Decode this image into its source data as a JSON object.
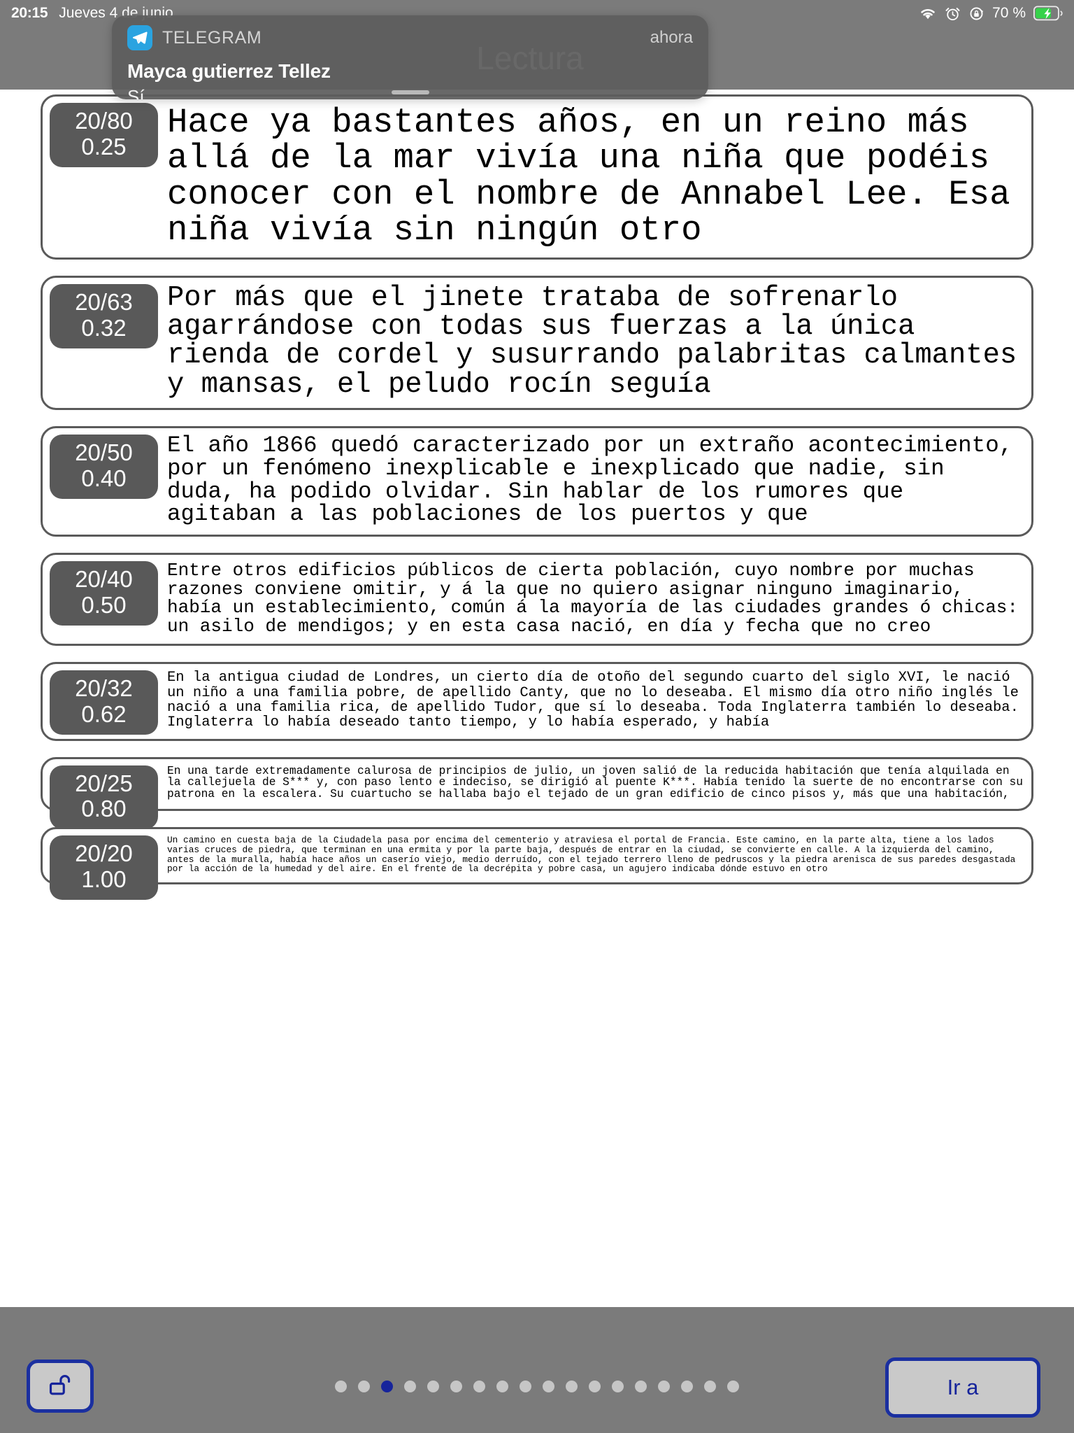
{
  "statusbar": {
    "time": "20:15",
    "date": "Jueves 4 de junio",
    "battery_percent": "70 %",
    "icons": [
      "wifi-icon",
      "alarm-icon",
      "rotation-lock-icon",
      "battery-charging-icon"
    ]
  },
  "header": {
    "title": "Lectura"
  },
  "notification": {
    "app_name": "TELEGRAM",
    "time": "ahora",
    "title": "Mayca gutierrez Tellez",
    "body": "Sí",
    "app_icon": "telegram-icon"
  },
  "cards": [
    {
      "acuity": "20/80",
      "decimal": "0.25",
      "text": "Hace ya bastantes años, en un reino más allá de la mar vivía una niña que podéis conocer con el nombre de Annabel Lee. Esa niña vivía sin ningún otro"
    },
    {
      "acuity": "20/63",
      "decimal": "0.32",
      "text": "Por más que el jinete trataba de sofrenarlo agarrándose con todas sus fuerzas a la única rienda de cordel y susurrando palabritas calmantes y mansas, el peludo rocín seguía"
    },
    {
      "acuity": "20/50",
      "decimal": "0.40",
      "text": "El año 1866 quedó caracterizado por un extraño acontecimiento, por un fenómeno inexplicable e inexplicado que nadie, sin duda, ha podido olvidar. Sin hablar de los rumores que agitaban a las poblaciones de los puertos y que"
    },
    {
      "acuity": "20/40",
      "decimal": "0.50",
      "text": "Entre otros edificios públicos de cierta población, cuyo nombre por muchas razones conviene omitir, y á la que no quiero asignar ninguno imaginario, había un establecimiento, común á la mayoría de las ciudades grandes ó chicas: un asilo de mendigos; y en esta casa nació, en día y fecha que no creo"
    },
    {
      "acuity": "20/32",
      "decimal": "0.62",
      "text": "En la antigua ciudad de Londres, un cierto día de otoño del segundo cuarto del siglo XVI, le nació un niño a una familia pobre, de apellido Canty, que no lo deseaba. El mismo día otro niño inglés le nació a una familia rica, de apellido Tudor, que sí lo deseaba. Toda Inglaterra también lo deseaba. Inglaterra lo había deseado tanto tiempo, y lo había esperado, y había"
    },
    {
      "acuity": "20/25",
      "decimal": "0.80",
      "text": "En una tarde extremadamente calurosa de principios de julio, un joven salió de la reducida habitación que tenía alquilada en la callejuela de S*** y, con paso lento e indeciso, se dirigió al puente K***. Había tenido la suerte de no encontrarse con su patrona en la escalera. Su cuartucho se hallaba bajo el tejado de un gran edificio de cinco pisos y, más que una habitación,"
    },
    {
      "acuity": "20/20",
      "decimal": "1.00",
      "text": "Un camino en cuesta baja de la Ciudadela pasa por encima del cementerio y atraviesa el portal de Francia. Este camino, en la parte alta, tiene a los lados varias cruces de piedra, que terminan en una ermita y por la parte baja, después de entrar en la ciudad, se convierte en calle. A la izquierda del camino, antes de la muralla, había hace años un caserío viejo, medio derruído, con el tejado terrero lleno de pedruscos y la piedra arenisca de sus paredes desgastada por la acción de la humedad y del aire. En el frente de la decrépita y pobre casa, un agujero indicaba dónde estuvo en otro"
    }
  ],
  "toolbar": {
    "lock_icon": "unlock-icon",
    "goto_label": "Ir a",
    "pager": {
      "total": 18,
      "active_index": 2
    }
  },
  "colors": {
    "accent_blue": "#16249b",
    "chrome_gray": "#7b7b7b",
    "badge_gray": "#595959",
    "card_border": "#5a5a5a",
    "telegram_blue": "#2aa3e0"
  }
}
